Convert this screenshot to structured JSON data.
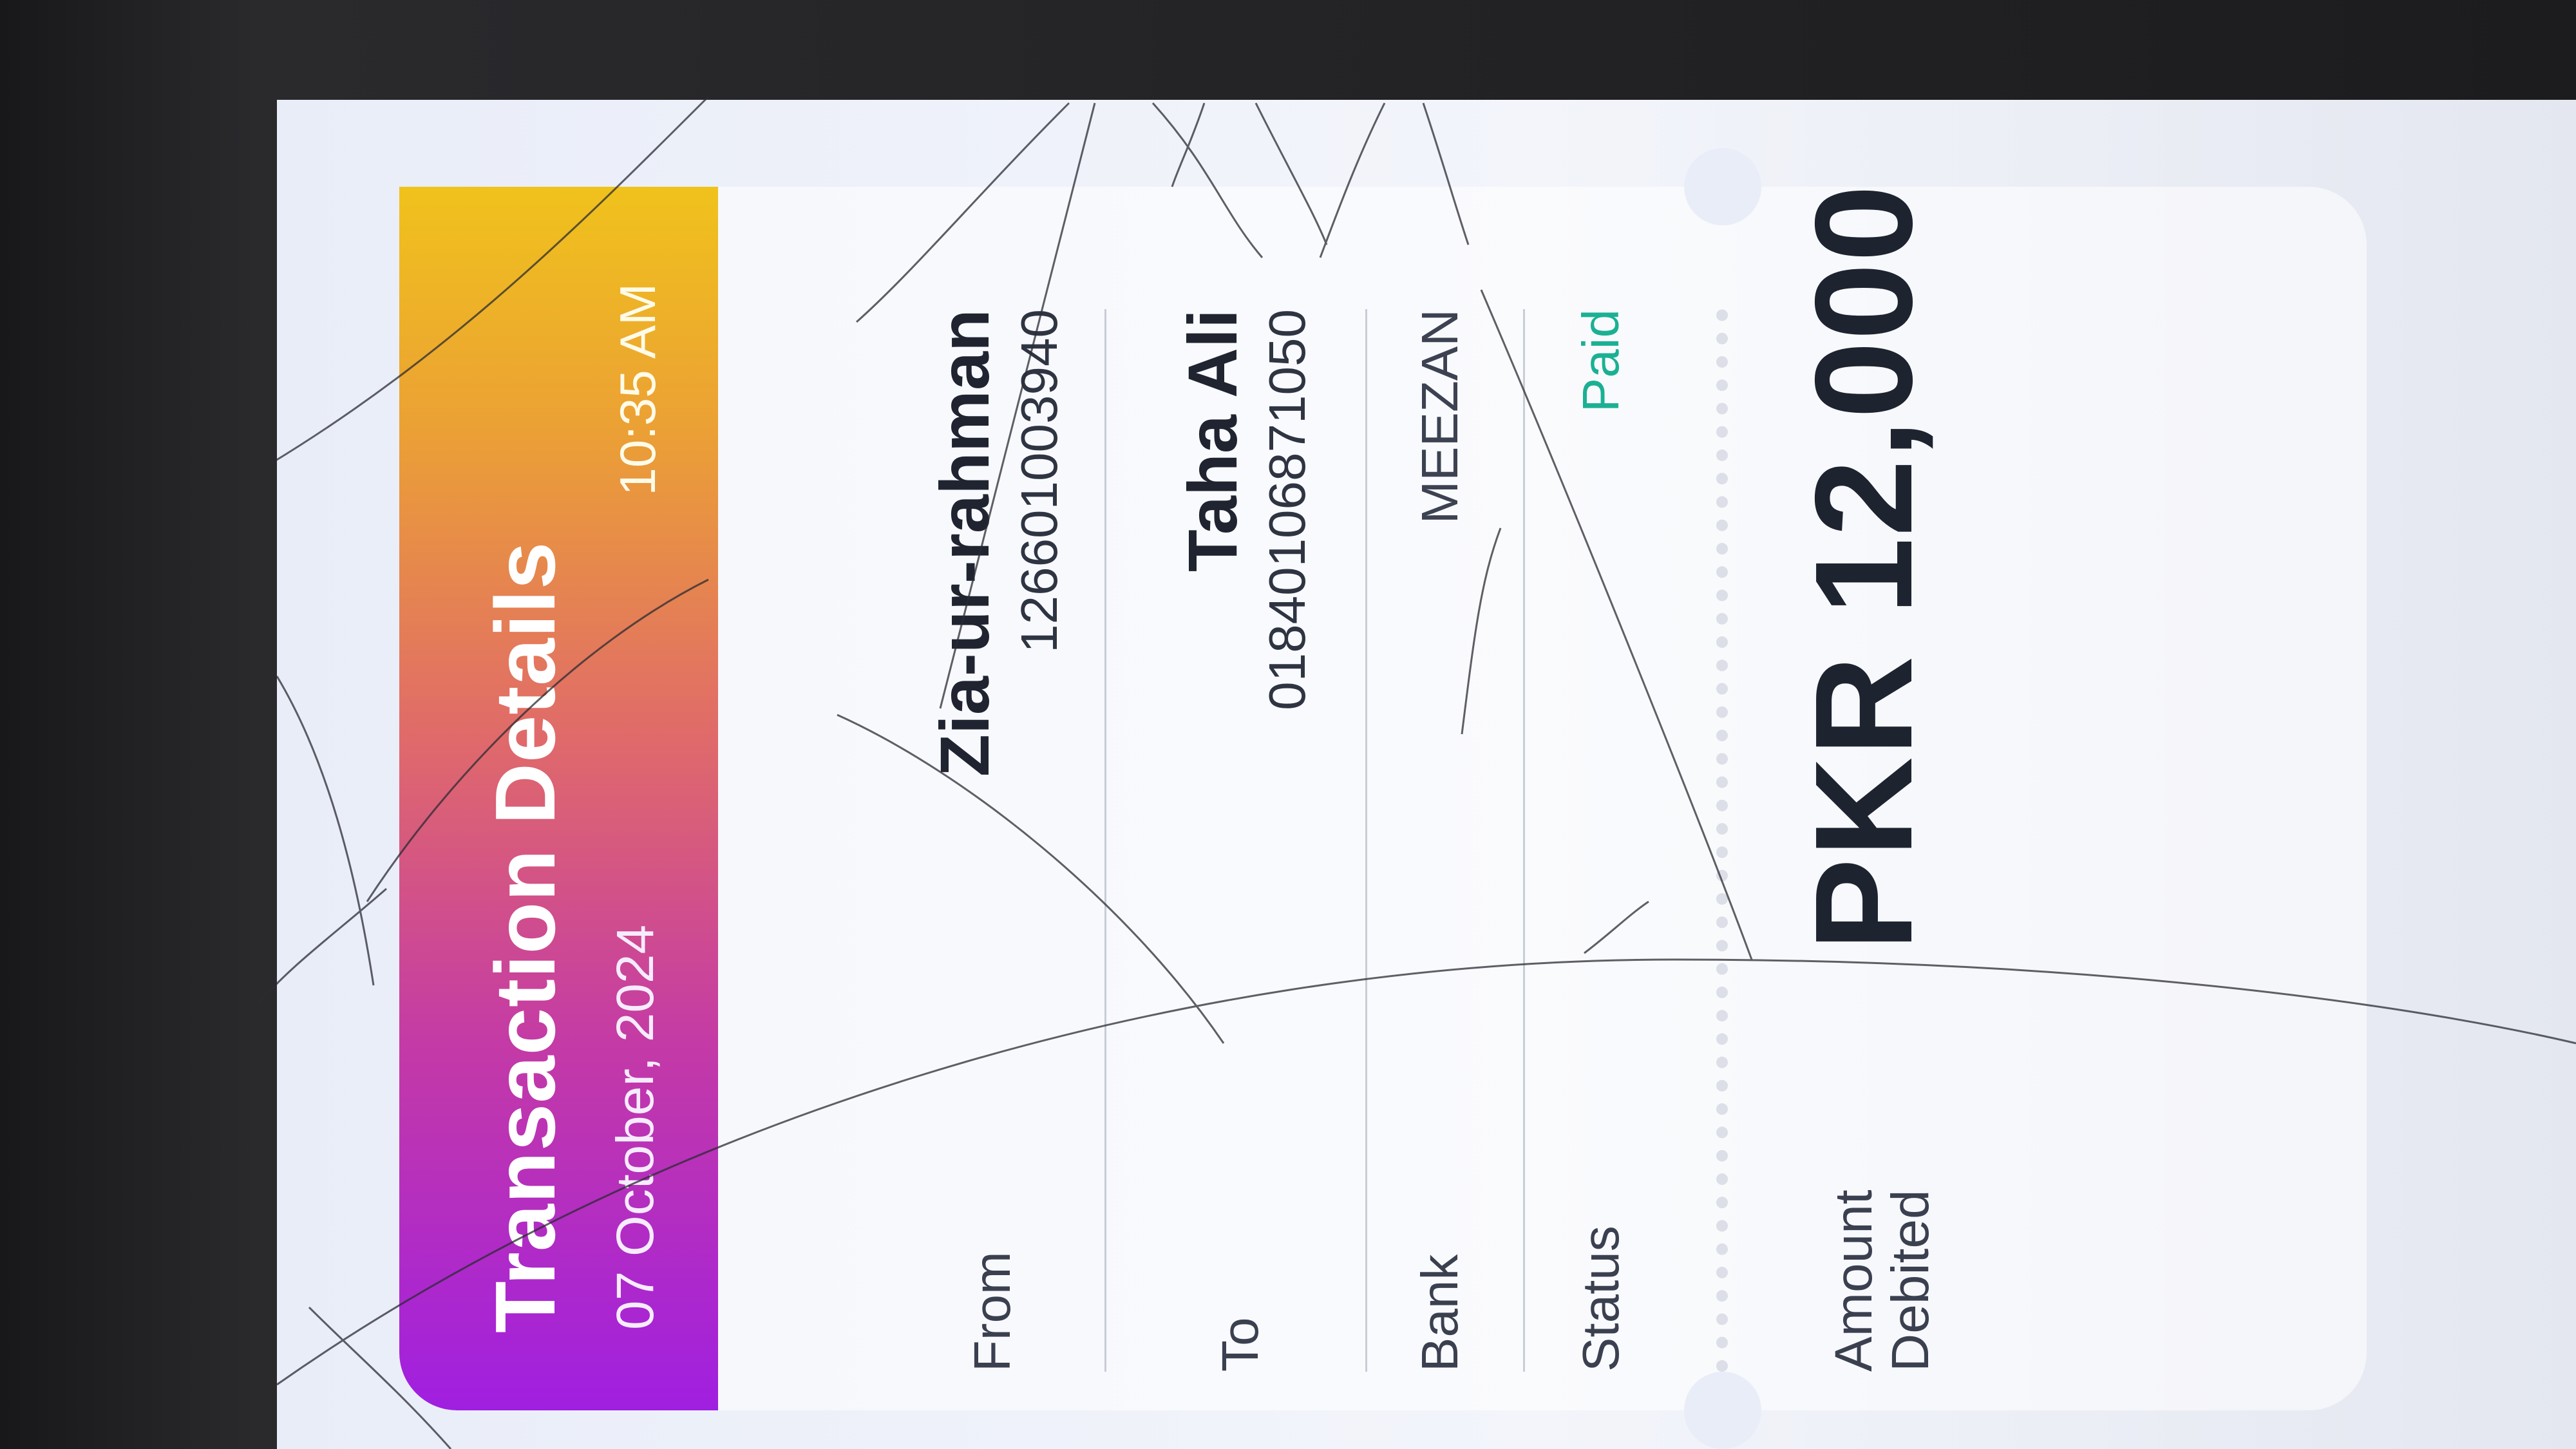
{
  "header": {
    "title": "Transaction Details",
    "date": "07 October, 2024",
    "time": "10:35 AM"
  },
  "from": {
    "label": "From",
    "name": "Zia-ur-rahman",
    "account": "126601003940"
  },
  "to": {
    "label": "To",
    "name": "Taha Ali",
    "account": "01840106871050"
  },
  "bank": {
    "label": "Bank",
    "value": "MEEZAN"
  },
  "status": {
    "label": "Status",
    "value": "Paid"
  },
  "amount": {
    "label_line1": "Amount",
    "label_line2": "Debited",
    "value": "PKR 12,000"
  },
  "colors": {
    "gradient_start": "#a01fe0",
    "gradient_end": "#f0c21c",
    "paid": "#1bb094"
  }
}
